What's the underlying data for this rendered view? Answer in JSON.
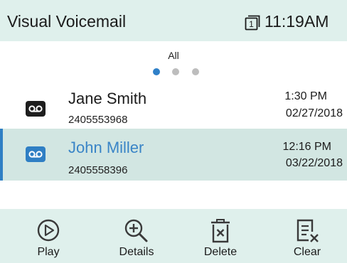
{
  "header": {
    "title": "Visual Voicemail",
    "line_number": "1",
    "time": "11:19AM"
  },
  "filter": {
    "label": "All",
    "pages": 3,
    "active_page": 1
  },
  "voicemails": [
    {
      "name": "Jane Smith",
      "number": "2405553968",
      "time": "1:30 PM",
      "date": "02/27/2018",
      "selected": false
    },
    {
      "name": "John Miller",
      "number": "2405558396",
      "time": "12:16 PM",
      "date": "03/22/2018",
      "selected": true
    }
  ],
  "toolbar": {
    "play_label": "Play",
    "details_label": "Details",
    "delete_label": "Delete",
    "clear_label": "Clear"
  },
  "icons": {
    "line": "line-key-icon",
    "voicemail": "voicemail-icon",
    "play": "play-circle-icon",
    "details": "zoom-in-icon",
    "delete": "trash-icon",
    "clear": "clear-list-icon"
  },
  "colors": {
    "header_bg": "#dff0ec",
    "selected_row_bg": "#d2e6e2",
    "accent": "#2f80c8"
  }
}
